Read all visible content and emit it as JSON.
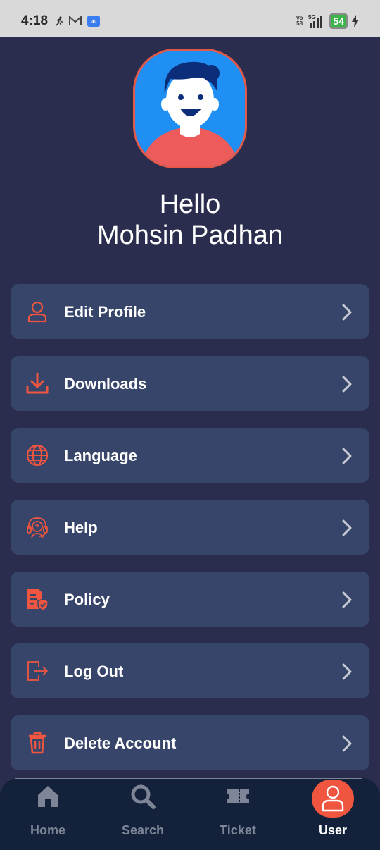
{
  "status_bar": {
    "time": "4:18",
    "network_top": "Vo",
    "network_bottom": "58",
    "signal_label": "5G",
    "battery": "54"
  },
  "profile": {
    "greeting": "Hello",
    "name": "Mohsin Padhan"
  },
  "menu": {
    "items": [
      {
        "label": "Edit Profile",
        "icon": "user-icon"
      },
      {
        "label": "Downloads",
        "icon": "download-icon"
      },
      {
        "label": "Language",
        "icon": "globe-icon"
      },
      {
        "label": "Help",
        "icon": "headset-icon"
      },
      {
        "label": "Policy",
        "icon": "policy-icon"
      },
      {
        "label": "Log Out",
        "icon": "logout-icon"
      },
      {
        "label": "Delete Account",
        "icon": "trash-icon"
      }
    ]
  },
  "bottom_nav": {
    "items": [
      {
        "label": "Home",
        "icon": "home-icon"
      },
      {
        "label": "Search",
        "icon": "search-icon"
      },
      {
        "label": "Ticket",
        "icon": "ticket-icon"
      },
      {
        "label": "User",
        "icon": "user-icon",
        "active": true
      }
    ]
  },
  "colors": {
    "background": "#2b2d4e",
    "card": "#38456b",
    "accent": "#f0553f",
    "nav_bg": "#13223a"
  }
}
